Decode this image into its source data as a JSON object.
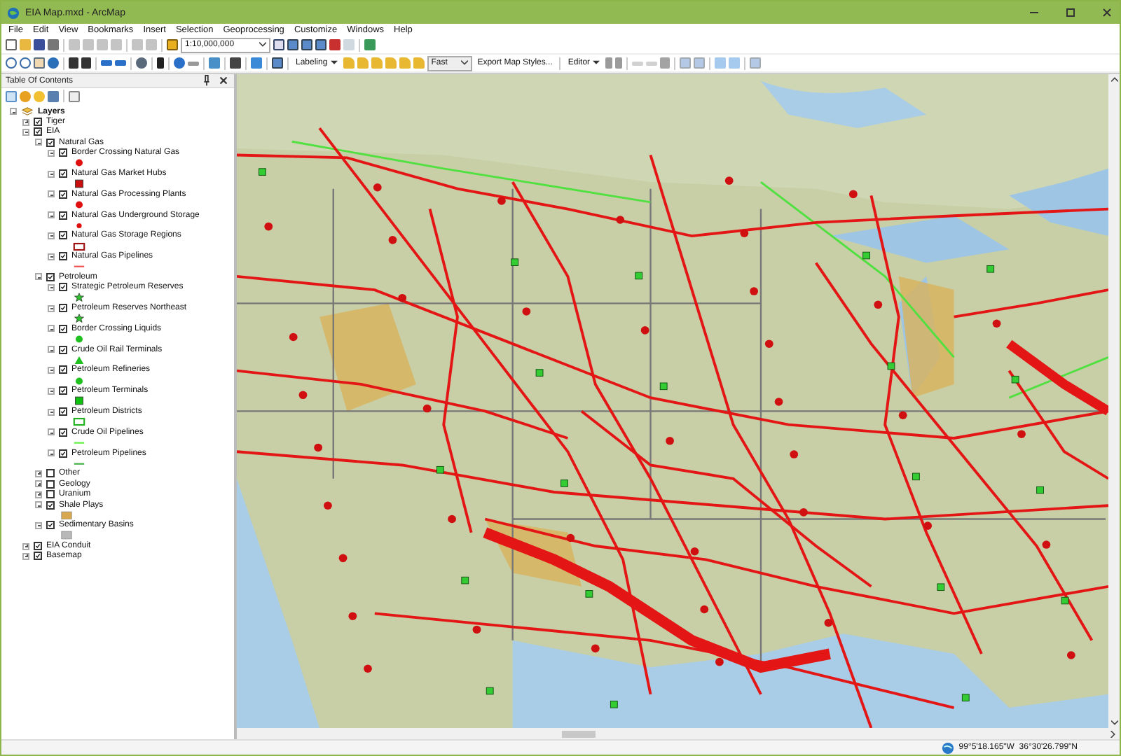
{
  "window": {
    "title": "EIA Map.mxd - ArcMap"
  },
  "menu": [
    "File",
    "Edit",
    "View",
    "Bookmarks",
    "Insert",
    "Selection",
    "Geoprocessing",
    "Customize",
    "Windows",
    "Help"
  ],
  "toolbar": {
    "scale": "1:10,000,000",
    "labeling": "Labeling",
    "draw_mode": "Fast",
    "export_styles": "Export Map Styles...",
    "editor": "Editor"
  },
  "toc": {
    "title": "Table Of Contents",
    "root": "Layers",
    "layers": [
      {
        "label": "Tiger",
        "checked": true,
        "expanded": false
      },
      {
        "label": "EIA",
        "checked": true,
        "expanded": true,
        "children": [
          {
            "label": "Natural Gas",
            "checked": true,
            "expanded": true,
            "children": [
              {
                "label": "Border Crossing Natural Gas",
                "checked": true,
                "expanded": true,
                "kind": "circle",
                "color": "#e01010"
              },
              {
                "label": "Natural Gas Market Hubs",
                "checked": true,
                "expanded": true,
                "kind": "square",
                "color": "#c81010"
              },
              {
                "label": "Natural Gas Processing Plants",
                "checked": true,
                "expanded": true,
                "kind": "circle",
                "color": "#e01010"
              },
              {
                "label": "Natural Gas Underground Storage",
                "checked": true,
                "expanded": true,
                "kind": "dot",
                "color": "#e01010"
              },
              {
                "label": "Natural Gas Storage Regions",
                "checked": true,
                "expanded": true,
                "kind": "outline",
                "color": "#a01010"
              },
              {
                "label": "Natural Gas Pipelines",
                "checked": true,
                "expanded": true,
                "kind": "line",
                "color": "#f05050"
              }
            ]
          },
          {
            "label": "Petroleum",
            "checked": true,
            "expanded": true,
            "children": [
              {
                "label": "Strategic Petroleum Reserves",
                "checked": true,
                "expanded": true,
                "kind": "star",
                "color": "#30c030"
              },
              {
                "label": "Petroleum Reserves Northeast",
                "checked": true,
                "expanded": true,
                "kind": "star",
                "color": "#30c030"
              },
              {
                "label": "Border Crossing Liquids",
                "checked": true,
                "expanded": true,
                "kind": "circle",
                "color": "#20c020"
              },
              {
                "label": "Crude Oil Rail Terminals",
                "checked": true,
                "expanded": true,
                "kind": "triangle",
                "color": "#20c020"
              },
              {
                "label": "Petroleum Refineries",
                "checked": true,
                "expanded": true,
                "kind": "circle",
                "color": "#20c020"
              },
              {
                "label": "Petroleum Terminals",
                "checked": true,
                "expanded": true,
                "kind": "square",
                "color": "#10c010"
              },
              {
                "label": "Petroleum Districts",
                "checked": true,
                "expanded": true,
                "kind": "outline",
                "color": "#20b020"
              },
              {
                "label": "Crude Oil Pipelines",
                "checked": true,
                "expanded": true,
                "kind": "line",
                "color": "#60f040"
              },
              {
                "label": "Petroleum Pipelines",
                "checked": true,
                "expanded": true,
                "kind": "line",
                "color": "#40b040"
              }
            ]
          },
          {
            "label": "Other",
            "checked": false,
            "expanded": false
          },
          {
            "label": "Geology",
            "checked": false,
            "expanded": false
          },
          {
            "label": "Uranium",
            "checked": false,
            "expanded": false
          },
          {
            "label": "Shale Plays",
            "checked": true,
            "expanded": true,
            "kind": "fill",
            "color": "#d8a850"
          },
          {
            "label": "Sedimentary Basins",
            "checked": true,
            "expanded": true,
            "kind": "fill",
            "color": "#b8b8b8"
          }
        ]
      },
      {
        "label": "EIA Conduit",
        "checked": true,
        "expanded": false
      },
      {
        "label": "Basemap",
        "checked": true,
        "expanded": false
      }
    ]
  },
  "status_bar": {
    "coordinates": "99°5'18.165\"W  36°30'26.799\"N"
  }
}
